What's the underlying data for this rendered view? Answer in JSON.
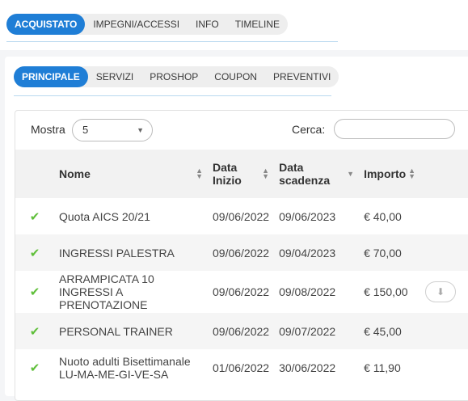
{
  "main_tabs": [
    {
      "label": "ACQUISTATO",
      "active": true
    },
    {
      "label": "IMPEGNI/ACCESSI",
      "active": false
    },
    {
      "label": "INFO",
      "active": false
    },
    {
      "label": "TIMELINE",
      "active": false
    }
  ],
  "sub_tabs": [
    {
      "label": "PRINCIPALE",
      "active": true
    },
    {
      "label": "SERVIZI",
      "active": false
    },
    {
      "label": "PROSHOP",
      "active": false
    },
    {
      "label": "COUPON",
      "active": false
    },
    {
      "label": "PREVENTIVI",
      "active": false
    }
  ],
  "controls": {
    "show_label": "Mostra",
    "show_value": "5",
    "search_label": "Cerca:",
    "search_value": ""
  },
  "table": {
    "headers": {
      "name": "Nome",
      "start": "Data Inizio",
      "end": "Data scadenza",
      "amount": "Importo"
    },
    "rows": [
      {
        "name": "Quota AICS 20/21",
        "start": "09/06/2022",
        "end": "09/06/2023",
        "amount": "€ 40,00",
        "download": false
      },
      {
        "name": "INGRESSI PALESTRA",
        "start": "09/06/2022",
        "end": "09/04/2023",
        "amount": "€ 70,00",
        "download": false
      },
      {
        "name": "ARRAMPICATA 10 INGRESSI A PRENOTAZIONE",
        "start": "09/06/2022",
        "end": "09/08/2022",
        "amount": "€ 150,00",
        "download": true
      },
      {
        "name": "PERSONAL TRAINER",
        "start": "09/06/2022",
        "end": "09/07/2022",
        "amount": "€ 45,00",
        "download": false
      },
      {
        "name": "Nuoto adulti Bisettimanale LU-MA-ME-GI-VE-SA",
        "start": "01/06/2022",
        "end": "30/06/2022",
        "amount": "€ 11,90",
        "download": false
      }
    ]
  },
  "colors": {
    "accent": "#1f7ed6",
    "check": "#5fbf3a"
  }
}
